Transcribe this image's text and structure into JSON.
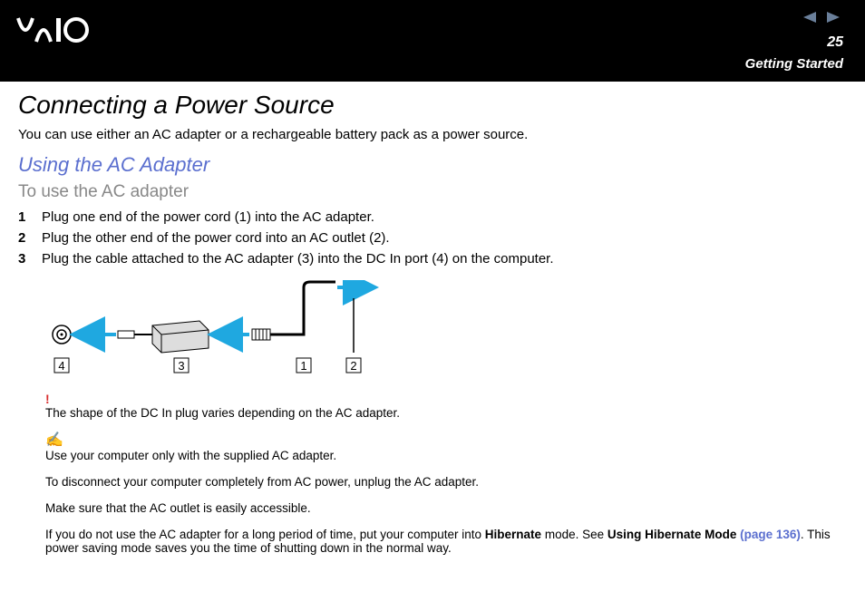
{
  "header": {
    "logo_text": "VAIO",
    "page_number": "25",
    "section": "Getting Started"
  },
  "title": "Connecting a Power Source",
  "intro": "You can use either an AC adapter or a rechargeable battery pack as a power source.",
  "subsection": "Using the AC Adapter",
  "procedure_title": "To use the AC adapter",
  "steps": [
    {
      "n": "1",
      "text": "Plug one end of the power cord (1) into the AC adapter."
    },
    {
      "n": "2",
      "text": "Plug the other end of the power cord into an AC outlet (2)."
    },
    {
      "n": "3",
      "text": "Plug the cable attached to the AC adapter (3) into the DC In port (4) on the computer."
    }
  ],
  "diagram_labels": {
    "l1": "1",
    "l2": "2",
    "l3": "3",
    "l4": "4"
  },
  "warning": {
    "icon": "!",
    "text": "The shape of the DC In plug varies depending on the AC adapter."
  },
  "note": {
    "icon": "✍",
    "p1": "Use your computer only with the supplied AC adapter.",
    "p2": "To disconnect your computer completely from AC power, unplug the AC adapter.",
    "p3": "Make sure that the AC outlet is easily accessible.",
    "p4_a": "If you do not use the AC adapter for a long period of time, put your computer into ",
    "p4_b": "Hibernate",
    "p4_c": " mode. See ",
    "p4_d": "Using Hibernate Mode ",
    "p4_link": "(page 136)",
    "p4_e": ". This power saving mode saves you the time of shutting down in the normal way."
  }
}
